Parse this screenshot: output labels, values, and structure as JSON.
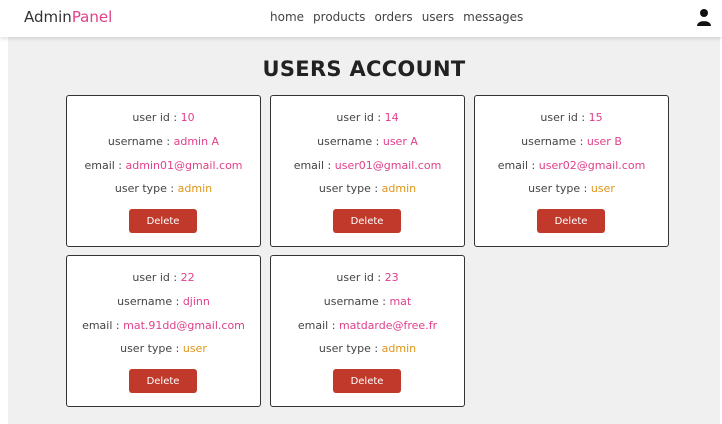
{
  "header": {
    "logo_main": "Admin",
    "logo_accent": "Panel",
    "nav": [
      "home",
      "products",
      "orders",
      "users",
      "messages"
    ]
  },
  "page": {
    "title": "USERS ACCOUNT"
  },
  "labels": {
    "user_id": "user id : ",
    "username": "username : ",
    "email": "email : ",
    "user_type": "user type : ",
    "delete": "Delete"
  },
  "users": [
    {
      "id": "10",
      "username": "admin A",
      "email": "admin01@gmail.com",
      "type": "admin"
    },
    {
      "id": "14",
      "username": "user A",
      "email": "user01@gmail.com",
      "type": "admin"
    },
    {
      "id": "15",
      "username": "user B",
      "email": "user02@gmail.com",
      "type": "user"
    },
    {
      "id": "22",
      "username": "djinn",
      "email": "mat.91dd@gmail.com",
      "type": "user"
    },
    {
      "id": "23",
      "username": "mat",
      "email": "matdarde@free.fr",
      "type": "admin"
    }
  ],
  "colors": {
    "accent": "#e0408a",
    "type_value": "#e0961a",
    "delete_button": "#c0392b",
    "background": "#f0f0f0"
  },
  "icons": {
    "profile": "user-icon"
  }
}
